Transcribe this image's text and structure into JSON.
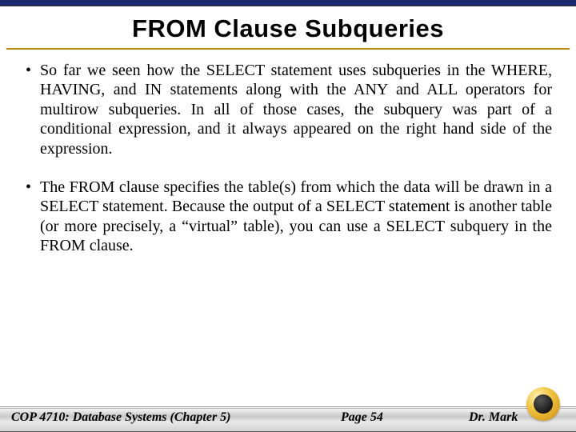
{
  "title": "FROM Clause Subqueries",
  "bullets": [
    "So far we seen how the SELECT statement uses subqueries in the WHERE, HAVING, and IN statements along with the ANY and ALL operators for multirow subqueries.  In all of those cases, the subquery was part of a conditional expression, and it always appeared on the right hand side of the expression.",
    "The FROM clause specifies the table(s) from which the data will be drawn in a SELECT statement.  Because the output of a SELECT statement is another table (or more precisely, a “virtual” table), you can use a SELECT subquery in the FROM clause."
  ],
  "footer": {
    "course": "COP 4710: Database Systems  (Chapter 5)",
    "page": "Page 54",
    "author": "Dr. Mark"
  }
}
